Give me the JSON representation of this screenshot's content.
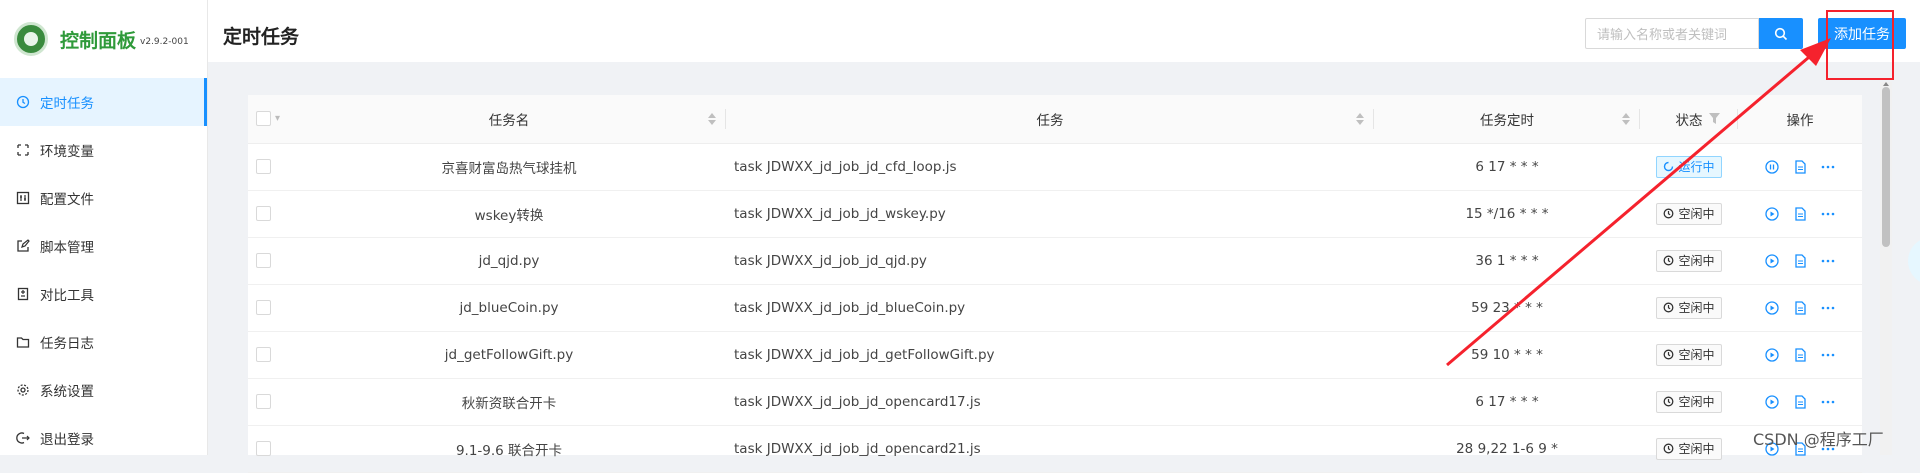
{
  "app": {
    "title": "控制面板",
    "version": "v2.9.2-001",
    "brand_color": "#2f9a3a"
  },
  "sidebar": {
    "items": [
      {
        "label": "定时任务",
        "icon": "clock-icon",
        "active": true
      },
      {
        "label": "环境变量",
        "icon": "variable-icon",
        "active": false
      },
      {
        "label": "配置文件",
        "icon": "config-icon",
        "active": false
      },
      {
        "label": "脚本管理",
        "icon": "edit-icon",
        "active": false
      },
      {
        "label": "对比工具",
        "icon": "diff-icon",
        "active": false
      },
      {
        "label": "任务日志",
        "icon": "folder-icon",
        "active": false
      },
      {
        "label": "系统设置",
        "icon": "gear-icon",
        "active": false
      },
      {
        "label": "退出登录",
        "icon": "logout-icon",
        "active": false
      }
    ]
  },
  "header": {
    "title": "定时任务",
    "search_placeholder": "请输入名称或者关键词",
    "add_label": "添加任务",
    "accent": "#1890ff"
  },
  "table": {
    "columns": [
      "任务名",
      "任务",
      "任务定时",
      "状态",
      "操作"
    ],
    "rows": [
      {
        "name": "京喜财富岛热气球挂机",
        "command": "task JDWXX_jd_job_jd_cfd_loop.js",
        "schedule": "6 17 * * *",
        "status": "运行中",
        "running": true
      },
      {
        "name": "wskey转换",
        "command": "task JDWXX_jd_job_jd_wskey.py",
        "schedule": "15 */16 * * *",
        "status": "空闲中",
        "running": false
      },
      {
        "name": "jd_qjd.py",
        "command": "task JDWXX_jd_job_jd_qjd.py",
        "schedule": "36 1 * * *",
        "status": "空闲中",
        "running": false
      },
      {
        "name": "jd_blueCoin.py",
        "command": "task JDWXX_jd_job_jd_blueCoin.py",
        "schedule": "59 23 * * *",
        "status": "空闲中",
        "running": false
      },
      {
        "name": "jd_getFollowGift.py",
        "command": "task JDWXX_jd_job_jd_getFollowGift.py",
        "schedule": "59 10 * * *",
        "status": "空闲中",
        "running": false
      },
      {
        "name": "秋新资联合开卡",
        "command": "task JDWXX_jd_job_jd_opencard17.js",
        "schedule": "6 17 * * *",
        "status": "空闲中",
        "running": false
      },
      {
        "name": "9.1-9.6 联合开卡",
        "command": "task JDWXX_jd_job_jd_opencard21.js",
        "schedule": "28 9,22 1-6 9 *",
        "status": "空闲中",
        "running": false
      }
    ]
  },
  "watermark": "CSDN @程序工厂",
  "annotation_color": "#f5222d"
}
